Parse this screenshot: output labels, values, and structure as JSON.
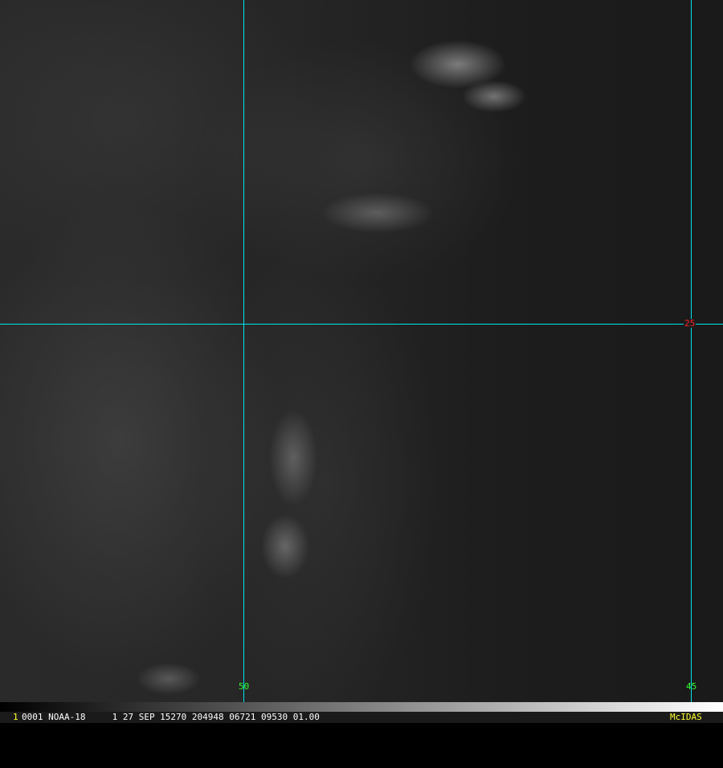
{
  "map": {
    "lat_label": "25",
    "lon_labels": [
      "50",
      "45"
    ],
    "grid_color": "#00e5ee",
    "lat_label_color": "#ff2020",
    "lon_label_color": "#30ff30"
  },
  "status": {
    "frame_number": "1",
    "info": "0001 NOAA-18     1 27 SEP 15270 204948 06721 09530 01.00",
    "brand": "McIDAS"
  }
}
